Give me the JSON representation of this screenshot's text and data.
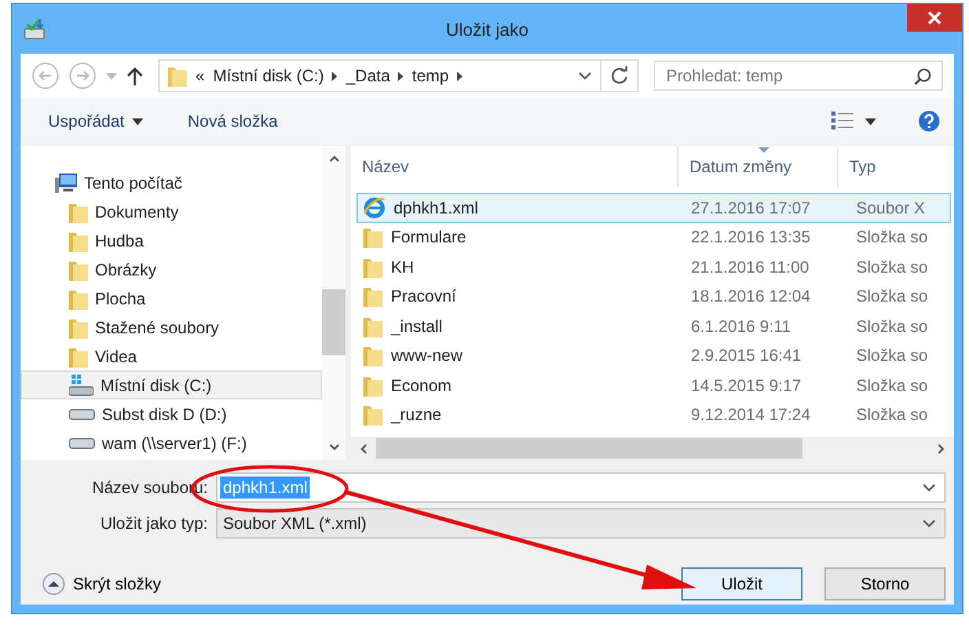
{
  "window": {
    "title": "Uložit jako"
  },
  "nav": {
    "overflow": "«",
    "breadcrumb": [
      "Místní disk (C:)",
      "_Data",
      "temp"
    ],
    "search": {
      "placeholder": "Prohledat: temp"
    }
  },
  "toolbar": {
    "organize": "Uspořádat",
    "new_folder": "Nová složka"
  },
  "sidebar": {
    "items": [
      {
        "label": "Tento počítač",
        "kind": "computer",
        "selected": false,
        "children": [
          {
            "label": "Dokumenty",
            "kind": "folder",
            "selected": false
          },
          {
            "label": "Hudba",
            "kind": "folder",
            "selected": false
          },
          {
            "label": "Obrázky",
            "kind": "folder",
            "selected": false
          },
          {
            "label": "Plocha",
            "kind": "folder",
            "selected": false
          },
          {
            "label": "Stažené soubory",
            "kind": "folder",
            "selected": false
          },
          {
            "label": "Videa",
            "kind": "folder",
            "selected": false
          },
          {
            "label": "Místní disk (C:)",
            "kind": "system-drive",
            "selected": true
          },
          {
            "label": "Subst disk D (D:)",
            "kind": "drive",
            "selected": false
          },
          {
            "label": "wam (\\\\server1) (F:)",
            "kind": "drive",
            "selected": false
          }
        ]
      }
    ]
  },
  "files": {
    "columns": [
      {
        "label": "Název",
        "sorted": false
      },
      {
        "label": "Datum změny",
        "sorted": true
      },
      {
        "label": "Typ",
        "sorted": false
      }
    ],
    "rows": [
      {
        "name": "dphkh1.xml",
        "date": "27.1.2016 17:07",
        "type": "Soubor X",
        "kind": "xml",
        "selected": true
      },
      {
        "name": "Formulare",
        "date": "22.1.2016 13:35",
        "type": "Složka so",
        "kind": "folder",
        "selected": false
      },
      {
        "name": "KH",
        "date": "21.1.2016 11:00",
        "type": "Složka so",
        "kind": "folder",
        "selected": false
      },
      {
        "name": "Pracovní",
        "date": "18.1.2016 12:04",
        "type": "Složka so",
        "kind": "folder",
        "selected": false
      },
      {
        "name": "_install",
        "date": "6.1.2016 9:11",
        "type": "Složka so",
        "kind": "folder",
        "selected": false
      },
      {
        "name": "www-new",
        "date": "2.9.2015 16:41",
        "type": "Složka so",
        "kind": "folder",
        "selected": false
      },
      {
        "name": "Econom",
        "date": "14.5.2015 9:17",
        "type": "Složka so",
        "kind": "folder",
        "selected": false
      },
      {
        "name": "_ruzne",
        "date": "9.12.2014 17:24",
        "type": "Složka so",
        "kind": "folder",
        "selected": false
      }
    ]
  },
  "filename": {
    "label": "Název souboru:",
    "value": "dphkh1.xml"
  },
  "filetype": {
    "label": "Uložit jako typ:",
    "value": "Soubor XML (*.xml)"
  },
  "hide_folders": "Skrýt složky",
  "buttons": [
    {
      "label": "Uložit",
      "default": true
    },
    {
      "label": "Storno",
      "default": false
    }
  ]
}
